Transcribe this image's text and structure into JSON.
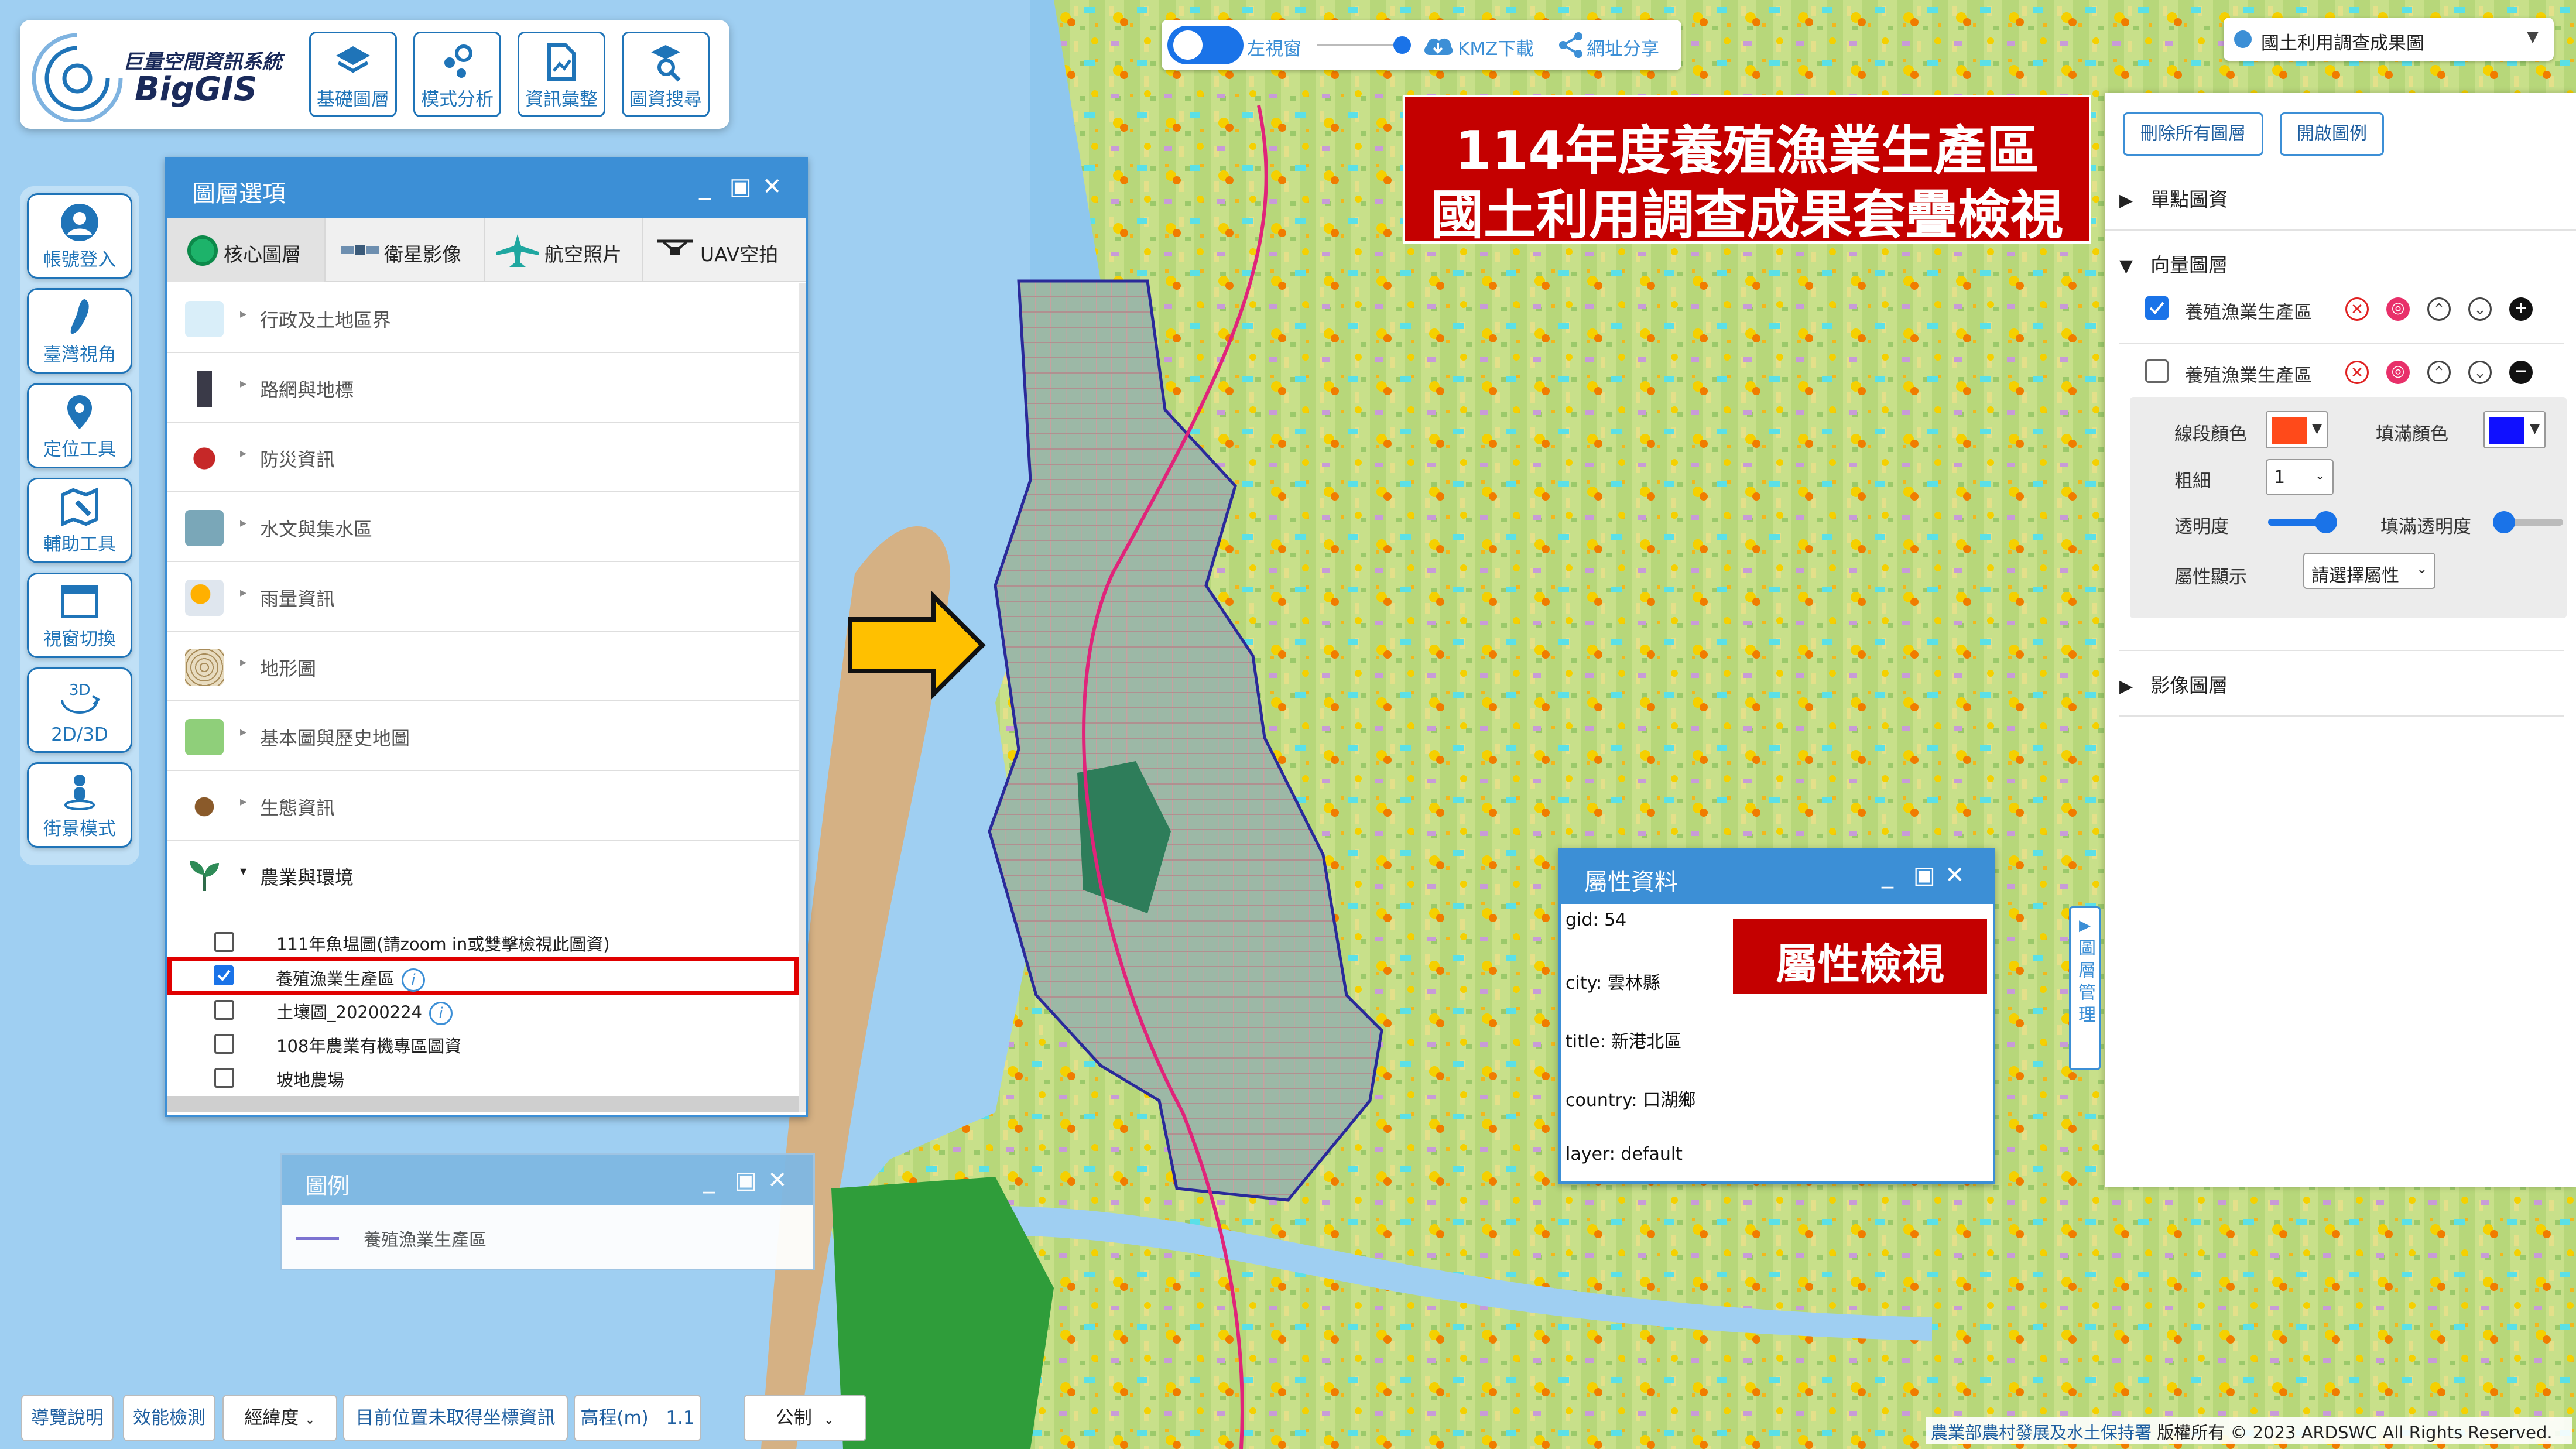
{
  "app": {
    "logo_subtitle": "巨量空間資訊系統",
    "logo_name": "BigGIS"
  },
  "top_buttons": [
    {
      "label": "基礎圖層",
      "icon": "layers-icon"
    },
    {
      "label": "模式分析",
      "icon": "analysis-icon"
    },
    {
      "label": "資訊彙整",
      "icon": "document-chart-icon"
    },
    {
      "label": "圖資搜尋",
      "icon": "search-map-icon"
    }
  ],
  "left_buttons": [
    {
      "label": "帳號登入",
      "icon": "user-icon"
    },
    {
      "label": "臺灣視角",
      "icon": "taiwan-icon"
    },
    {
      "label": "定位工具",
      "icon": "location-pin-icon"
    },
    {
      "label": "輔助工具",
      "icon": "map-tool-icon"
    },
    {
      "label": "視窗切換",
      "icon": "window-icon"
    },
    {
      "label": "2D/3D",
      "icon": "3d-rotate-icon",
      "badge": "3D"
    },
    {
      "label": "街景模式",
      "icon": "street-view-icon"
    }
  ],
  "layer_panel": {
    "title": "圖層選項",
    "tabs": [
      {
        "label": "核心圖層",
        "active": true
      },
      {
        "label": "衛星影像",
        "active": false
      },
      {
        "label": "航空照片",
        "active": false
      },
      {
        "label": "UAV空拍",
        "active": false
      }
    ],
    "categories": [
      {
        "label": "行政及土地區界",
        "icon": "admin-boundary-icon",
        "color": "#d9eef9"
      },
      {
        "label": "路網與地標",
        "icon": "road-icon",
        "color": "#ffffff"
      },
      {
        "label": "防災資訊",
        "icon": "disaster-icon",
        "color": "#ffffff"
      },
      {
        "label": "水文與集水區",
        "icon": "hydrology-icon",
        "color": "#7aa7b8"
      },
      {
        "label": "雨量資訊",
        "icon": "rain-icon",
        "color": "#ffffff"
      },
      {
        "label": "地形圖",
        "icon": "terrain-icon",
        "color": "#e8dcc0"
      },
      {
        "label": "基本圖與歷史地圖",
        "icon": "base-map-icon",
        "color": "#8fcf7a"
      },
      {
        "label": "生態資訊",
        "icon": "ecology-icon",
        "color": "#ffffff"
      }
    ],
    "expanded_category": "農業與環境",
    "sub_items": [
      {
        "label": "111年魚塭圖(請zoom in或雙擊檢視此圖資)",
        "checked": false,
        "info": false
      },
      {
        "label": "養殖漁業生產區",
        "checked": true,
        "info": true
      },
      {
        "label": "土壤圖_20200224",
        "checked": false,
        "info": true
      },
      {
        "label": "108年農業有機專區圖資",
        "checked": false,
        "info": false
      },
      {
        "label": "坡地農場",
        "checked": false,
        "info": false
      }
    ],
    "info_symbol": "i"
  },
  "legend": {
    "title": "圖例",
    "item": "養殖漁業生產區",
    "line_color": "#7b6fd0"
  },
  "toolbar": {
    "left_view": "左視窗",
    "kmz": "KMZ下載",
    "share": "網址分享"
  },
  "basemap_select": {
    "value": "國土利用調查成果圖"
  },
  "banner": {
    "line1": "114年度養殖漁業生產區",
    "line2": "國土利用調查成果套疊檢視"
  },
  "right_panel": {
    "remove_all": "刪除所有圖層",
    "open_legend": "開啟圖例",
    "sections": {
      "point": "單點圖資",
      "vector": "向量圖層",
      "image": "影像圖層"
    },
    "layers": [
      {
        "label": "養殖漁業生產區",
        "checked": true,
        "toggle": "+"
      },
      {
        "label": "養殖漁業生產區",
        "checked": false,
        "toggle": "−"
      }
    ],
    "settings": {
      "line_color_label": "線段顏色",
      "line_color": "#ff4a1a",
      "fill_color_label": "填滿顏色",
      "fill_color": "#1010ff",
      "width_label": "粗細",
      "width_value": "1",
      "opacity_label": "透明度",
      "opacity_value": 1,
      "fill_opacity_label": "填滿透明度",
      "fill_opacity_value": 0.15,
      "attr_label": "屬性顯示",
      "attr_select": "請選擇屬性"
    }
  },
  "attr_panel": {
    "title": "屬性資料",
    "lines": [
      "gid: 54",
      "city: 雲林縣",
      "title: 新港北區",
      "country: 口湖鄉",
      "layer: default"
    ]
  },
  "inspect_label": "屬性檢視",
  "side_tab": "圖層管理",
  "bottom_bar": {
    "guide": "導覽說明",
    "performance": "效能檢測",
    "coord_select": "經緯度",
    "position": "目前位置未取得坐標資訊",
    "elevation": "高程(m)",
    "elevation_value": "1.1",
    "unit_select": "公制"
  },
  "copyright": {
    "org": "農業部農村發展及水土保持署",
    "text": "版權所有 © 2023 ARDSWC All Rights Reserved."
  },
  "colors": {
    "accent": "#3c8fd6",
    "banner_red": "#c40000",
    "arrow_yellow": "#ffc000",
    "highlight_red": "#e00000"
  }
}
